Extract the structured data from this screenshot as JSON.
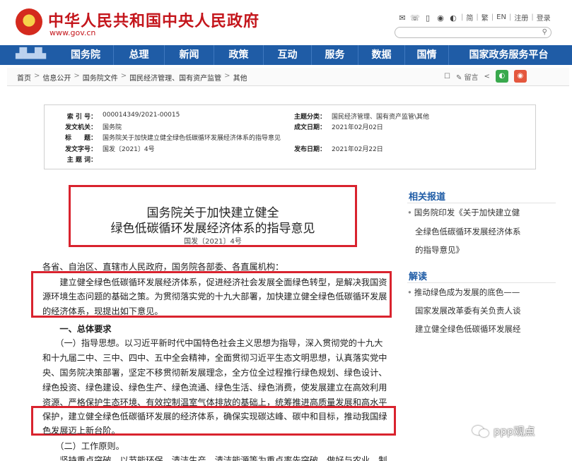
{
  "header": {
    "site_title": "中华人民共和国中央人民政府",
    "site_url": "www.gov.cn",
    "top_links": [
      "简",
      "繁",
      "EN",
      "注册",
      "登录"
    ],
    "search_placeholder": "",
    "icons": [
      "mail-icon",
      "phone-icon",
      "mobile-icon",
      "weibo-icon",
      "wechat-icon"
    ]
  },
  "nav": {
    "items": [
      "国务院",
      "总理",
      "新闻",
      "政策",
      "互动",
      "服务",
      "数据",
      "国情",
      "国家政务服务平台"
    ]
  },
  "breadcrumb": {
    "items": [
      "首页",
      "信息公开",
      "国务院文件",
      "国民经济管理、国有资产监管",
      "其他"
    ],
    "separator": ">",
    "tools": {
      "print": "☐",
      "comment": "留言",
      "share": "<"
    }
  },
  "meta": {
    "index_label": "索 引 号：",
    "index_value": "000014349/2021-00015",
    "issuer_label": "发文机关：",
    "issuer_value": "国务院",
    "title_label": "标　　题：",
    "title_value": "国务院关于加快建立健全绿色低碳循环发展经济体系的指导意见",
    "doc_no_label": "发文字号：",
    "doc_no_value": "国发〔2021〕4号",
    "subject_label": "主 题 词：",
    "subject_value": "",
    "category_label": "主题分类：",
    "category_value": "国民经济管理、国有资产监管\\其他",
    "written_label": "成文日期：",
    "written_value": "2021年02月02日",
    "published_label": "发布日期：",
    "published_value": "2021年02月22日"
  },
  "article": {
    "title_line1": "国务院关于加快建立健全",
    "title_line2": "绿色低碳循环发展经济体系的指导意见",
    "doc_number": "国发〔2021〕4号",
    "salutation": "各省、自治区、直辖市人民政府，国务院各部委、各直属机构：",
    "intro_lines": [
      "　　建立健全绿色低碳循环发展经济体系，促进经济社会发展全面绿色转型，是解决我国资",
      "源环境生态问题的基础之策。为贯彻落实党的十九大部署，加快建立健全绿色低碳循环发展",
      "的经济体系，现提出如下意见。"
    ],
    "section1_heading": "　　一、总体要求",
    "body_lines": [
      "　　（一）指导思想。以习近平新时代中国特色社会主义思想为指导，深入贯彻党的十九大",
      "和十九届二中、三中、四中、五中全会精神，全面贯彻习近平生态文明思想，认真落实党中",
      "央、国务院决策部署，坚定不移贯彻新发展理念，全方位全过程推行绿色规划、绿色设计、",
      "绿色投资、绿色建设、绿色生产、绿色流通、绿色生活、绿色消费，使发展建立在高效利用",
      "资源、严格保护生态环境、有效控制温室气体排放的基础上，统筹推进高质量发展和高水平",
      "保护，建立健全绿色低碳循环发展的经济体系，确保实现碳达峰、碳中和目标，推动我国绿",
      "色发展迈上新台阶。"
    ],
    "principle_line": "　　（二）工作原则。",
    "cut_line": "　　坚持重点突破。以节能环保、清洁生产、清洁能源等为重点率先突破，做好与农业、制"
  },
  "sidebar": {
    "related_heading": "相关报道",
    "related_lines": [
      "国务院印发《关于加快建立健",
      "全绿色低碳循环发展经济体系",
      "的指导意见》"
    ],
    "interpret_heading": "解读",
    "interpret_lines": [
      "推动绿色成为发展的底色——",
      "国家发展改革委有关负责人谈",
      "建立健全绿色低碳循环发展经"
    ]
  },
  "watermark": {
    "text": "ppp观点"
  },
  "colors": {
    "brand_red": "#c4161c",
    "nav_blue": "#1f5ca6",
    "highlight_red": "#d9232e"
  }
}
